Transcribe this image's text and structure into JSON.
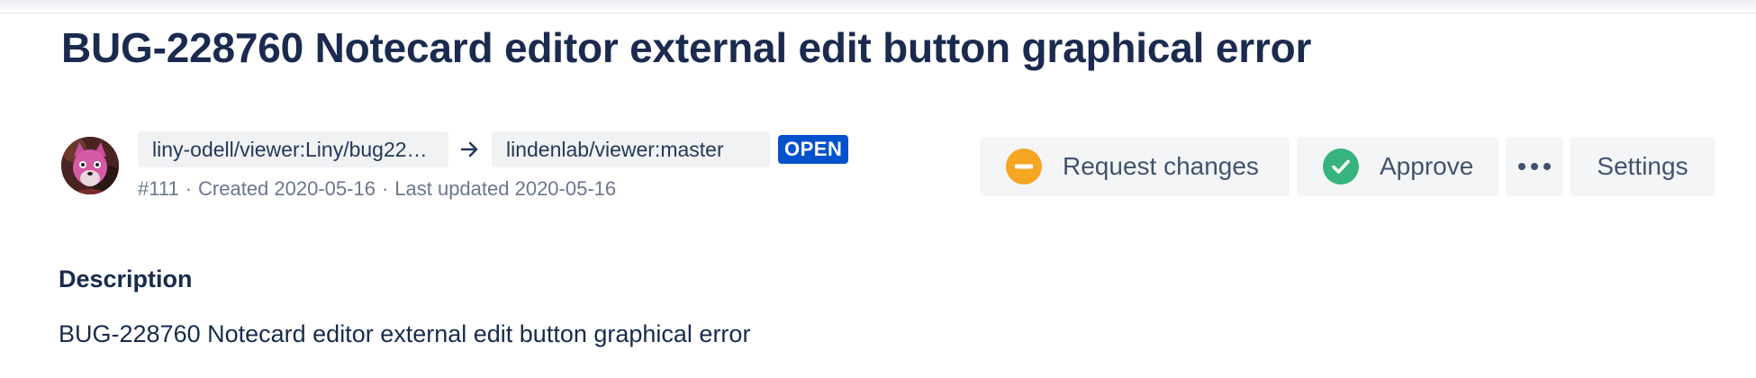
{
  "pull_request": {
    "title": "BUG-228760 Notecard editor external edit button graphical error",
    "source_branch": "liny-odell/viewer:Liny/bug22…",
    "destination_branch": "lindenlab/viewer:master",
    "status": "OPEN",
    "id": "#111",
    "created": "Created 2020-05-16",
    "updated": "Last updated 2020-05-16",
    "meta_separator": "·"
  },
  "actions": {
    "request_changes_label": "Request changes",
    "approve_label": "Approve",
    "settings_label": "Settings"
  },
  "description": {
    "heading": "Description",
    "body": "BUG-228760 Notecard editor external edit button graphical error"
  },
  "icons": {
    "request_changes": "minus-circle-icon",
    "approve": "check-circle-icon",
    "more": "more-horizontal-icon",
    "arrow": "arrow-right-icon"
  },
  "colors": {
    "status_open": "#0052cc",
    "request_changes": "#f5a623",
    "approve": "#36b37e",
    "title": "#1b2a4e"
  }
}
